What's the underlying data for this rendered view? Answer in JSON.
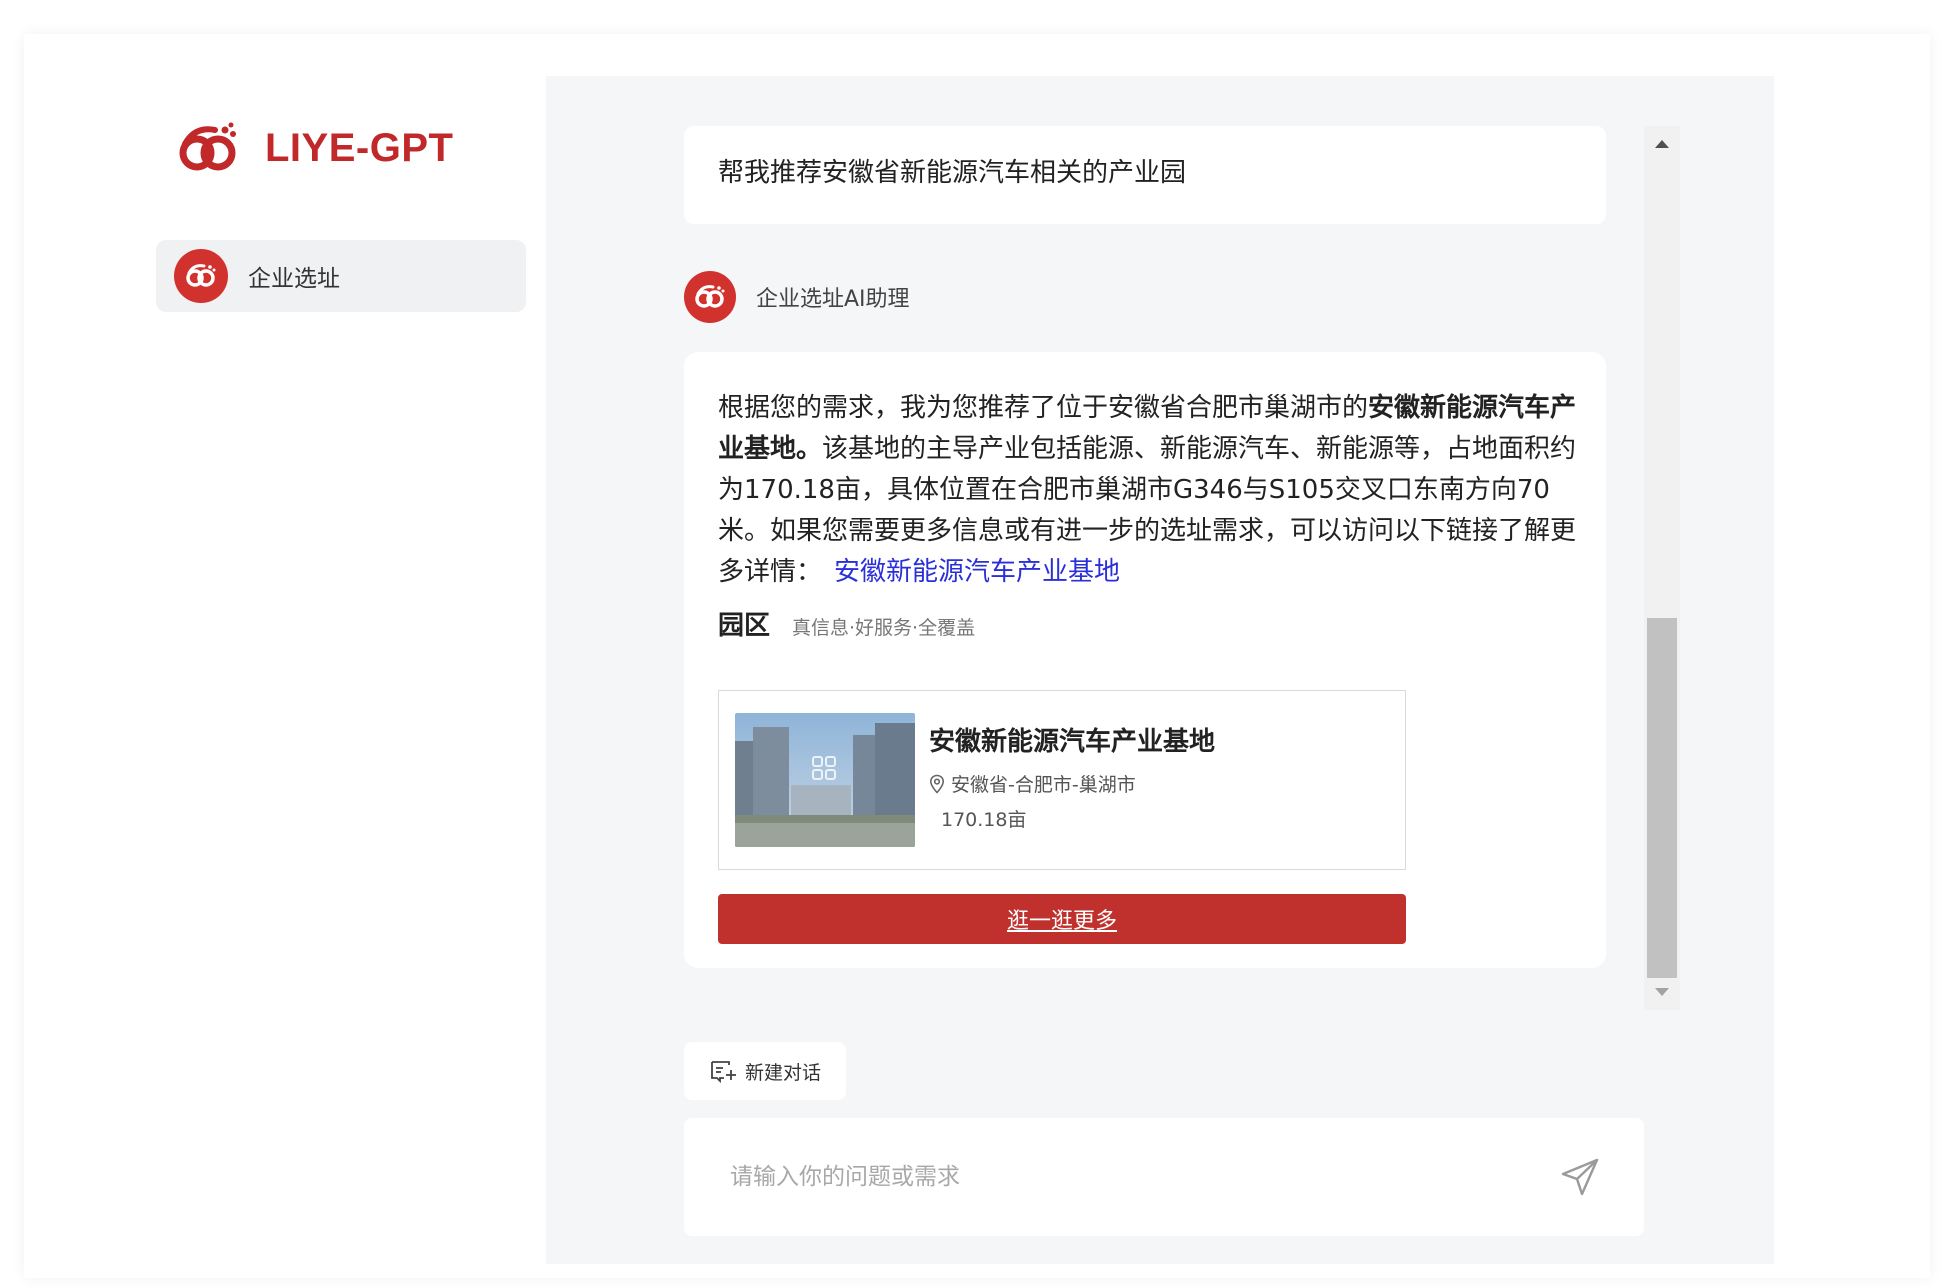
{
  "brand": {
    "name": "LIYE-GPT",
    "logo_icon": "intertwined-rings-logo",
    "accent": "#c0282a"
  },
  "sidebar": {
    "items": [
      {
        "label": "企业选址",
        "icon": "brand-avatar",
        "selected": true
      }
    ]
  },
  "chat": {
    "user_message": "帮我推荐安徽省新能源汽车相关的产业园",
    "assistant": {
      "name": "企业选址AI助理",
      "answer_prefix": "根据您的需求，我为您推荐了位于安徽省合肥市巢湖市的",
      "answer_bold": "安徽新能源汽车产业基地。",
      "answer_suffix": "该基地的主导产业包括能源、新能源汽车、新能源等，占地面积约为170.18亩，具体位置在合肥市巢湖市G346与S105交叉口东南方向70米。如果您需要更多信息或有进一步的选址需求，可以访问以下链接了解更多详情：",
      "link_text": "安徽新能源汽车产业基地",
      "park_section_title": "园区",
      "park_section_subtitle": "真信息·好服务·全覆盖",
      "park_card": {
        "name": "安徽新能源汽车产业基地",
        "location": "安徽省-合肥市-巢湖市",
        "area": "170.18亩"
      },
      "more_button": "逛一逛更多"
    }
  },
  "actions": {
    "new_chat": "新建对话"
  },
  "input": {
    "placeholder": "请输入你的问题或需求",
    "value": ""
  }
}
